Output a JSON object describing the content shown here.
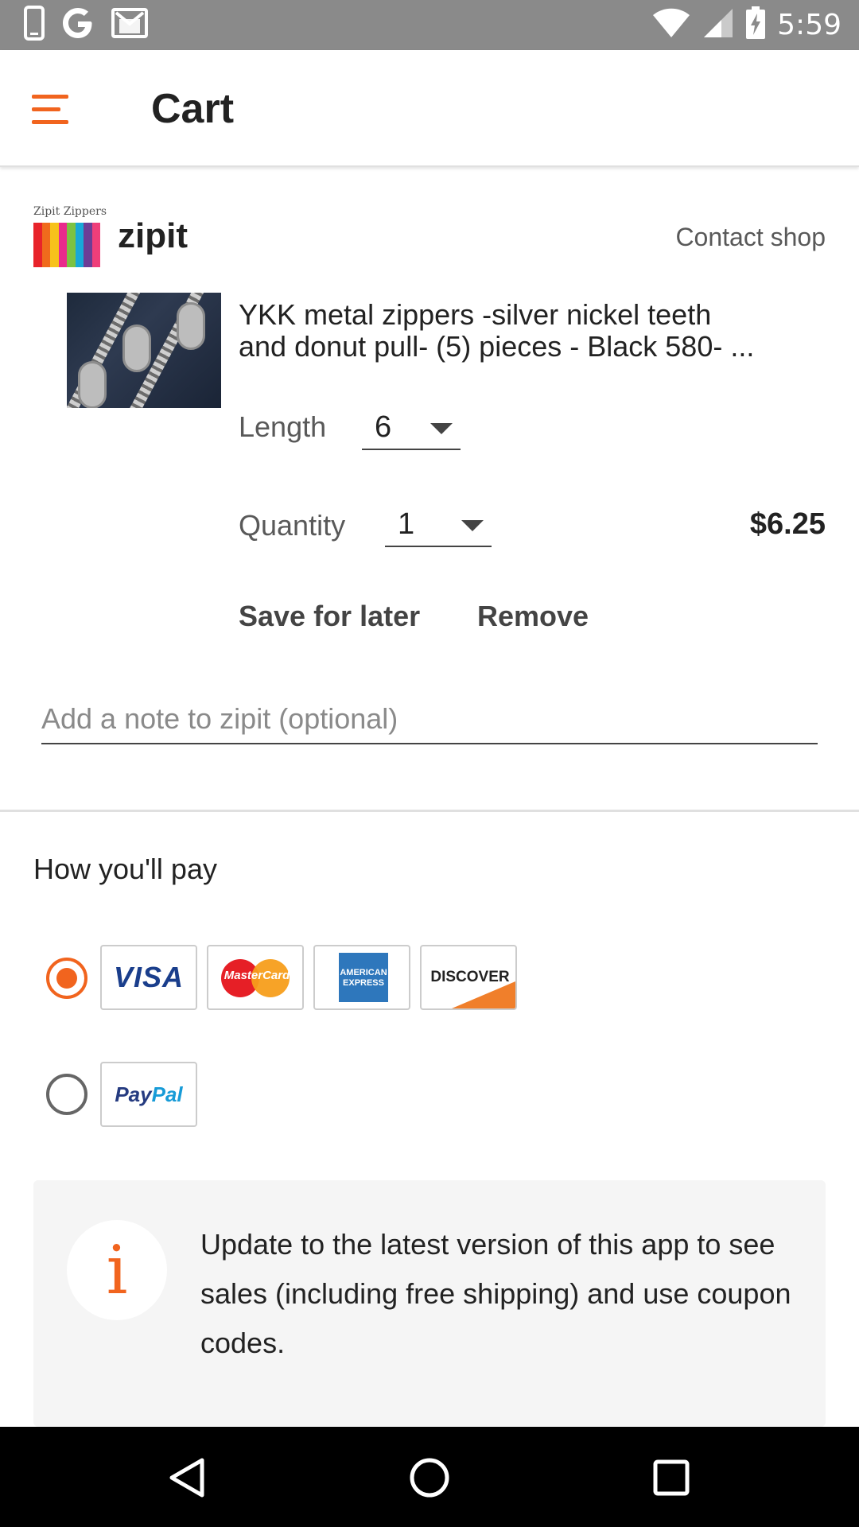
{
  "status_bar": {
    "time": "5:59"
  },
  "app_bar": {
    "title": "Cart"
  },
  "shop": {
    "logo_text": "Zipit Zippers",
    "name": "zipit",
    "contact_label": "Contact shop"
  },
  "item": {
    "title_line1": "YKK metal zippers -silver nickel teeth",
    "title_line2": "and donut pull- (5) pieces - Black 580- ...",
    "length_label": "Length",
    "length_value": "6",
    "quantity_label": "Quantity",
    "quantity_value": "1",
    "price": "$6.25",
    "save_for_later_label": "Save for later",
    "remove_label": "Remove"
  },
  "note": {
    "placeholder": "Add a note to zipit (optional)"
  },
  "payment": {
    "section_title": "How you'll pay",
    "card_brands": {
      "visa": "VISA",
      "mastercard": "MasterCard",
      "amex_line1": "AMERICAN",
      "amex_line2": "EXPRESS",
      "discover": "DISCOVER",
      "paypal_part1": "Pay",
      "paypal_part2": "Pal"
    },
    "selected_option": "cards"
  },
  "info": {
    "icon_glyph": "i",
    "text": "Update to the latest version of this app to see sales (including free shipping) and use coupon codes."
  },
  "colors": {
    "accent": "#f1641e",
    "status_bar": "#8a8a8a",
    "info_background": "#f5f5f5",
    "nav_bar": "#000000"
  },
  "icons": {
    "status_left": [
      "phone-icon",
      "google-icon",
      "gmail-icon"
    ],
    "status_right": [
      "wifi-icon",
      "signal-icon",
      "battery-charging-icon"
    ],
    "nav": [
      "back-icon",
      "home-icon",
      "recents-icon"
    ]
  }
}
